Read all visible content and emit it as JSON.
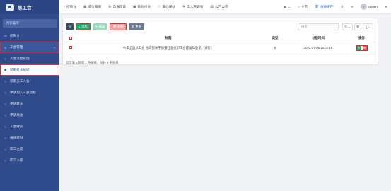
{
  "sidebar": {
    "logo": "总工会",
    "search_placeholder": "搜索菜单",
    "items": [
      {
        "label": "控制台",
        "icon": "monitor-icon"
      },
      {
        "label": "工会管理",
        "icon": "menu-icon"
      },
      {
        "label": "入会流程管理",
        "icon": "circle-icon"
      },
      {
        "label": "新职社会组织",
        "icon": "circle-icon"
      },
      {
        "label": "新职员工入会",
        "icon": "circle-icon"
      },
      {
        "label": "申请加入工会流程",
        "icon": "circle-icon"
      },
      {
        "label": "申请转会",
        "icon": "circle-icon"
      },
      {
        "label": "申请离会",
        "icon": "circle-icon"
      },
      {
        "label": "工会财务",
        "icon": "circle-icon"
      },
      {
        "label": "维修建制",
        "icon": "circle-icon"
      },
      {
        "label": "职工之家",
        "icon": "circle-icon"
      },
      {
        "label": "职工小家",
        "icon": "circle-icon"
      }
    ]
  },
  "topbar": {
    "menu": [
      {
        "label": "控制台",
        "icon": "dashboard-icon"
      },
      {
        "label": "单位概况",
        "icon": "building-icon"
      },
      {
        "label": "自身建设",
        "icon": "gear-icon"
      },
      {
        "label": "就业创业",
        "icon": "briefcase-icon"
      },
      {
        "label": "爱心驿站",
        "icon": "heart-icon"
      },
      {
        "label": "工人先锋号",
        "icon": "flag-icon"
      },
      {
        "label": "公告公开",
        "icon": "document-icon"
      }
    ],
    "home": "主页",
    "clear_cache": "清除缓存",
    "user": "Admin"
  },
  "toolbar": {
    "refresh": "",
    "add": "添加",
    "edit": "编辑",
    "delete": "删除",
    "more": "更多",
    "search_placeholder": "搜索"
  },
  "table": {
    "headers": [
      "",
      "标题",
      "类型",
      "创建时间",
      "操作"
    ],
    "rows": [
      {
        "title": "中华全国总工会 民政部关于加强社会组织工会建设的意见（试行）",
        "type": "5",
        "created": "2022-07-08 10:07:16"
      }
    ]
  },
  "footer": "显示第 1 到第 1 条记录，总共 1 条记录",
  "colors": {
    "sidebar": "#2f4b8c",
    "add": "#1aaa6c",
    "delete": "#e04b4b",
    "highlight": "#e1272d"
  }
}
